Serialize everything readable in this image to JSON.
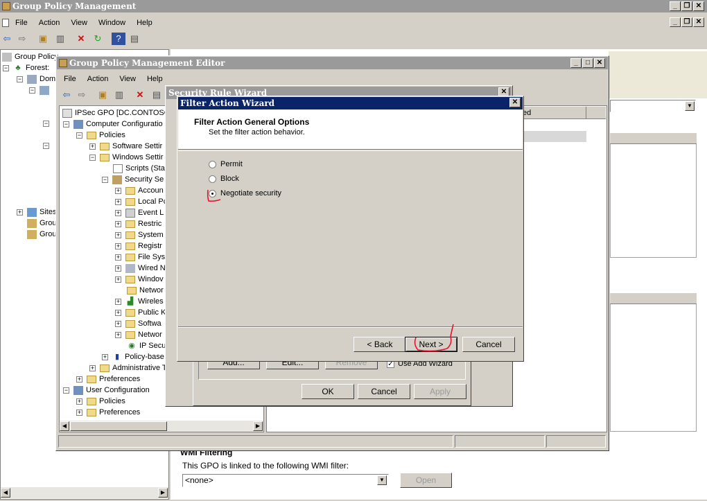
{
  "gpm": {
    "title": "Group Policy Management",
    "menu": [
      "File",
      "Action",
      "View",
      "Window",
      "Help"
    ],
    "tree": [
      {
        "label": "Group Policy"
      },
      {
        "label": "Forest:"
      },
      {
        "label": "Dom"
      },
      {
        "label": "Sites"
      },
      {
        "label": "Grou"
      },
      {
        "label": "Grou"
      }
    ],
    "wmi": {
      "heading": "WMI Filtering",
      "description": "This GPO is linked to the following WMI filter:",
      "selected": "<none>",
      "open_label": "Open"
    }
  },
  "gpme": {
    "title": "Group Policy Management Editor",
    "menu": [
      "File",
      "Action",
      "View",
      "Help"
    ],
    "tree": [
      {
        "label": "IPSec GPO [DC.CONTOSO."
      },
      {
        "label": "Computer Configuratio"
      },
      {
        "label": "Policies"
      },
      {
        "label": "Software Settir"
      },
      {
        "label": "Windows Settir"
      },
      {
        "label": "Scripts (Sta"
      },
      {
        "label": "Security Se"
      },
      {
        "label": "Accoun"
      },
      {
        "label": "Local Pc"
      },
      {
        "label": "Event L"
      },
      {
        "label": "Restric"
      },
      {
        "label": "System"
      },
      {
        "label": "Registr"
      },
      {
        "label": "File Sys"
      },
      {
        "label": "Wired N"
      },
      {
        "label": "Windov"
      },
      {
        "label": "Networ"
      },
      {
        "label": "Wireles"
      },
      {
        "label": "Public K"
      },
      {
        "label": "Softwa"
      },
      {
        "label": "Networ"
      },
      {
        "label": "IP Secu"
      },
      {
        "label": "Policy-base"
      },
      {
        "label": "Administrative Template"
      },
      {
        "label": "Preferences"
      },
      {
        "label": "User Configuration"
      },
      {
        "label": "Policies"
      },
      {
        "label": "Preferences"
      }
    ],
    "column_header": "ed"
  },
  "security_rule_wizard": {
    "title": "Security Rule Wizard",
    "add_label": "Add...",
    "edit_label": "Edit...",
    "remove_label": "Remove",
    "use_add_wizard_label": "Use Add Wizard",
    "ok_label": "OK",
    "cancel_label": "Cancel",
    "apply_label": "Apply"
  },
  "filter_action_wizard": {
    "title": "Filter Action Wizard",
    "heading": "Filter Action General Options",
    "subheading": "Set the filter action behavior.",
    "options": [
      {
        "label": "Permit",
        "selected": false
      },
      {
        "label": "Block",
        "selected": false
      },
      {
        "label": "Negotiate security",
        "selected": true
      }
    ],
    "back_label": "< Back",
    "next_label": "Next >",
    "cancel_label": "Cancel"
  },
  "colors": {
    "active_title": "#0a246a",
    "inactive_title": "#808080",
    "window_bg": "#d4d0c8",
    "annotation": "#e8102a"
  }
}
